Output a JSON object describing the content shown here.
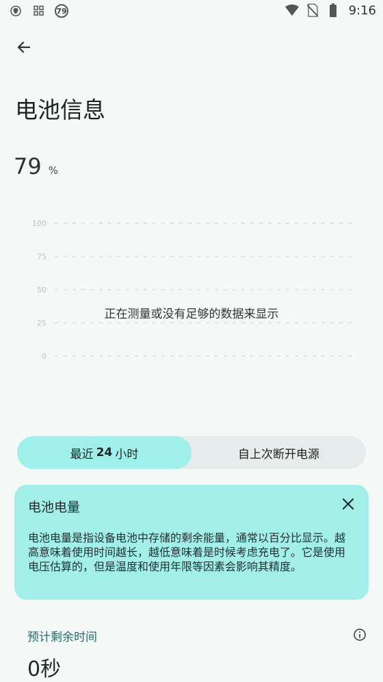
{
  "status_bar": {
    "time": "9:16",
    "notification_badge": "79",
    "icons": [
      "vpn-shield-icon",
      "grid-app-icon",
      "wifi-icon",
      "no-sim-icon",
      "battery-icon"
    ]
  },
  "header": {
    "title": "电池信息"
  },
  "battery": {
    "level": "79",
    "unit": "%"
  },
  "chart_data": {
    "type": "line",
    "yticks": [
      "100",
      "75",
      "50",
      "25",
      "0"
    ],
    "ylim": [
      0,
      100
    ],
    "grid": true,
    "series": [],
    "empty_message": "正在测量或没有足够的数据来显示"
  },
  "toggle": {
    "options": [
      {
        "prefix": "最近",
        "bold": "24",
        "suffix": "小时",
        "selected": true
      },
      {
        "prefix": "自上次断开电源",
        "bold": "",
        "suffix": "",
        "selected": false
      }
    ]
  },
  "info_card": {
    "title": "电池电量",
    "body": "电池电量是指设备电池中存储的剩余能量，通常以百分比显示。越高意味着使用时间越长，越低意味着是时候考虑充电了。它是使用电压估算的，但是温度和使用年限等因素会影响其精度。"
  },
  "estimate": {
    "label": "预计剩余时间",
    "value": "0秒"
  },
  "colors": {
    "background": "#f4f9f8",
    "accent": "#9ff0ea",
    "teal_text": "#1e6b6a",
    "grid": "#dbe6e4"
  }
}
